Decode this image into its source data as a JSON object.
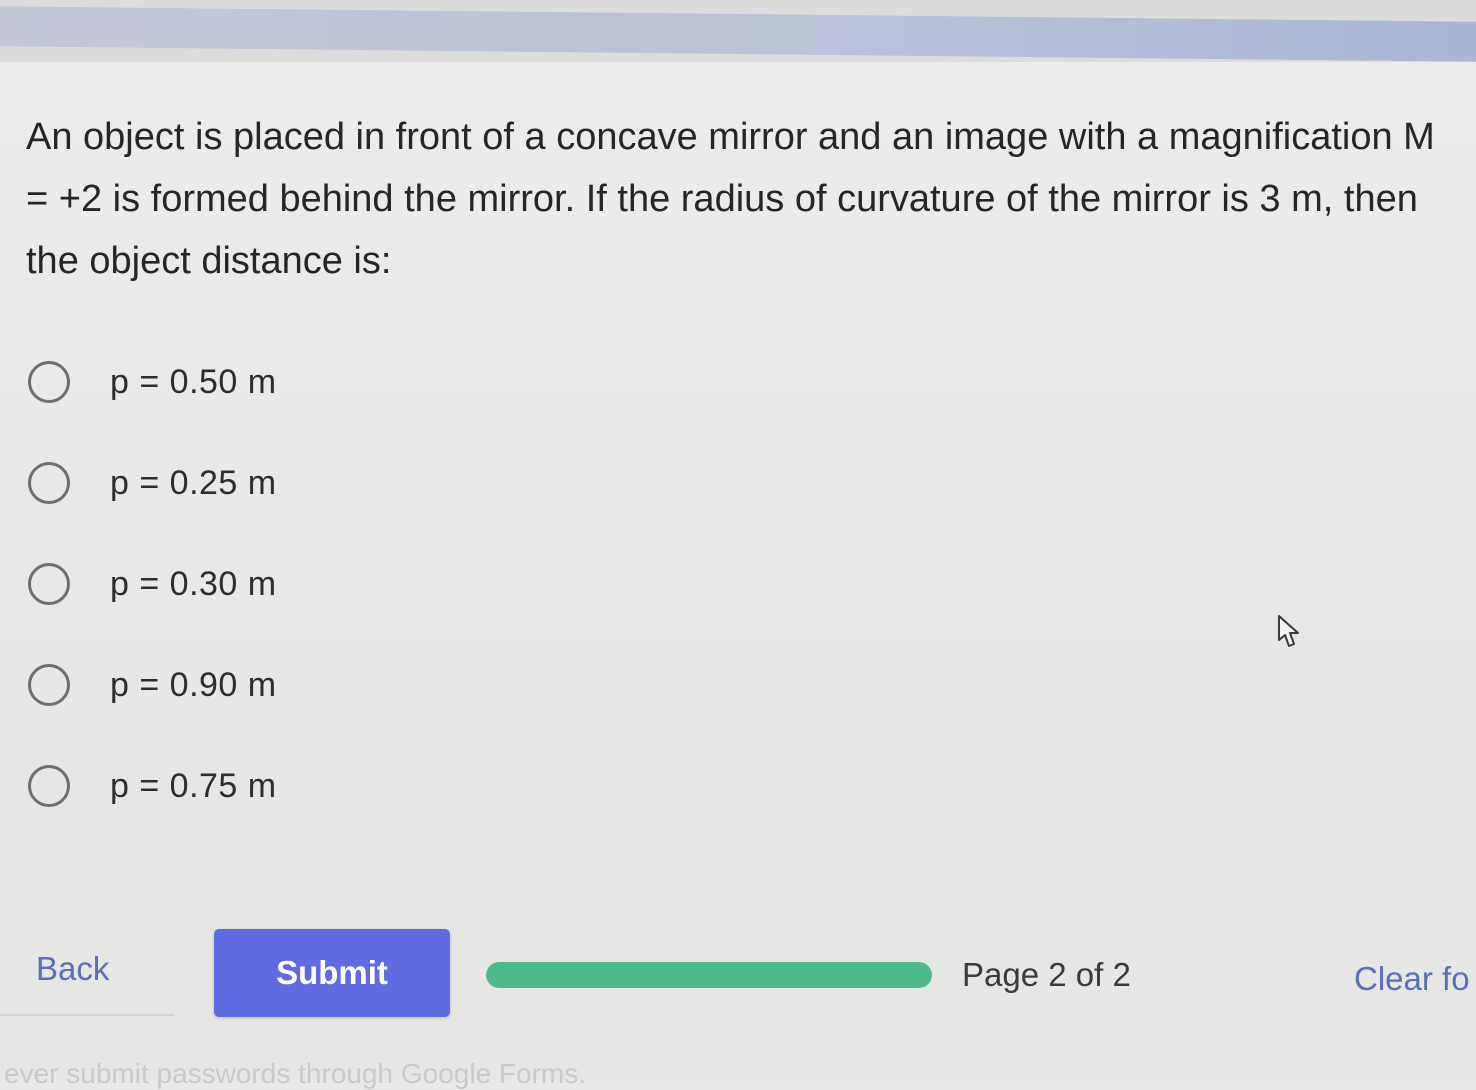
{
  "question": {
    "text": "An object is placed in front of a concave mirror and an image with a magnification M = +2 is formed behind the mirror. If the radius of curvature of the mirror is 3 m, then the object distance is:"
  },
  "options": [
    {
      "label": "p = 0.50 m"
    },
    {
      "label": "p = 0.25 m"
    },
    {
      "label": "p = 0.30 m"
    },
    {
      "label": "p = 0.90 m"
    },
    {
      "label": "p = 0.75 m"
    }
  ],
  "footer": {
    "back_label": "Back",
    "submit_label": "Submit",
    "progress_fraction": 1.0,
    "page_indicator": "Page 2 of 2",
    "clear_label": "Clear fo"
  },
  "bottom_note": "ever submit passwords through Google Forms.",
  "colors": {
    "submit_bg": "#5f6ce0",
    "progress_fill": "#4cba8a",
    "link": "#5b6fb8"
  }
}
